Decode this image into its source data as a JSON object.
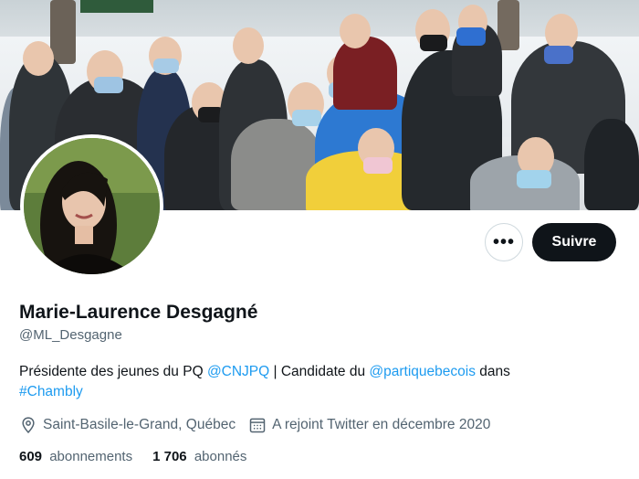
{
  "profile": {
    "name": "Marie-Laurence Desgagné",
    "handle": "@ML_Desgagne",
    "bio": {
      "part1": "Présidente des jeunes du PQ ",
      "mention1": "@CNJPQ",
      "part2": " | Candidate du ",
      "mention2": "@partiquebecois",
      "part3": " dans",
      "hashtag": "#Chambly"
    },
    "location": "Saint-Basile-le-Grand, Québec",
    "joined": "A rejoint Twitter en décembre 2020",
    "following_count": "609",
    "following_label": "abonnements",
    "followers_count": "1 706",
    "followers_label": "abonnés"
  },
  "actions": {
    "more_label": "•••",
    "follow_label": "Suivre"
  },
  "icons": {
    "location": "location-pin-icon",
    "calendar": "calendar-icon"
  },
  "colors": {
    "link": "#1d9bf0",
    "follow_button": "#0f1419",
    "secondary_text": "#536471"
  }
}
